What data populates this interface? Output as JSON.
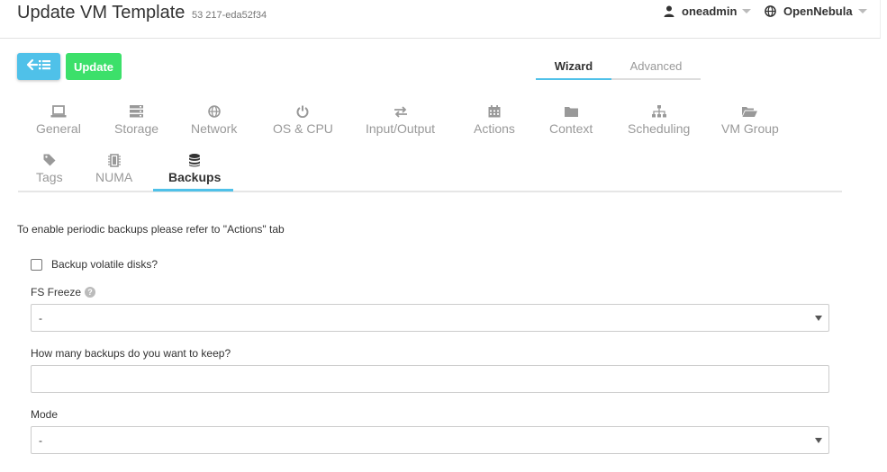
{
  "header": {
    "title": "Update VM Template",
    "subtitle": "53 217-eda52f34",
    "user": "oneadmin",
    "zone": "OpenNebula"
  },
  "toolbar": {
    "update_label": "Update"
  },
  "mode_tabs": [
    {
      "label": "Wizard",
      "active": true
    },
    {
      "label": "Advanced",
      "active": false
    }
  ],
  "tabs": [
    {
      "label": "General",
      "icon": "laptop-icon"
    },
    {
      "label": "Storage",
      "icon": "storage-icon"
    },
    {
      "label": "Network",
      "icon": "globe-icon"
    },
    {
      "label": "OS & CPU",
      "icon": "power-icon"
    },
    {
      "label": "Input/Output",
      "icon": "exchange-icon"
    },
    {
      "label": "Actions",
      "icon": "calendar-icon"
    },
    {
      "label": "Context",
      "icon": "folder-icon"
    },
    {
      "label": "Scheduling",
      "icon": "sitemap-icon"
    },
    {
      "label": "VM Group",
      "icon": "folder-open-icon"
    },
    {
      "label": "Tags",
      "icon": "tag-icon"
    },
    {
      "label": "NUMA",
      "icon": "chip-icon"
    },
    {
      "label": "Backups",
      "icon": "database-icon",
      "active": true
    }
  ],
  "form": {
    "info": "To enable periodic backups please refer to \"Actions\" tab",
    "volatile_label": "Backup volatile disks?",
    "fs_freeze_label": "FS Freeze",
    "fs_freeze_value": "-",
    "keep_label": "How many backups do you want to keep?",
    "keep_value": "",
    "mode_label": "Mode",
    "mode_value": "-"
  },
  "colors": {
    "accent": "#4fc1e9",
    "update": "#3ce06a"
  }
}
